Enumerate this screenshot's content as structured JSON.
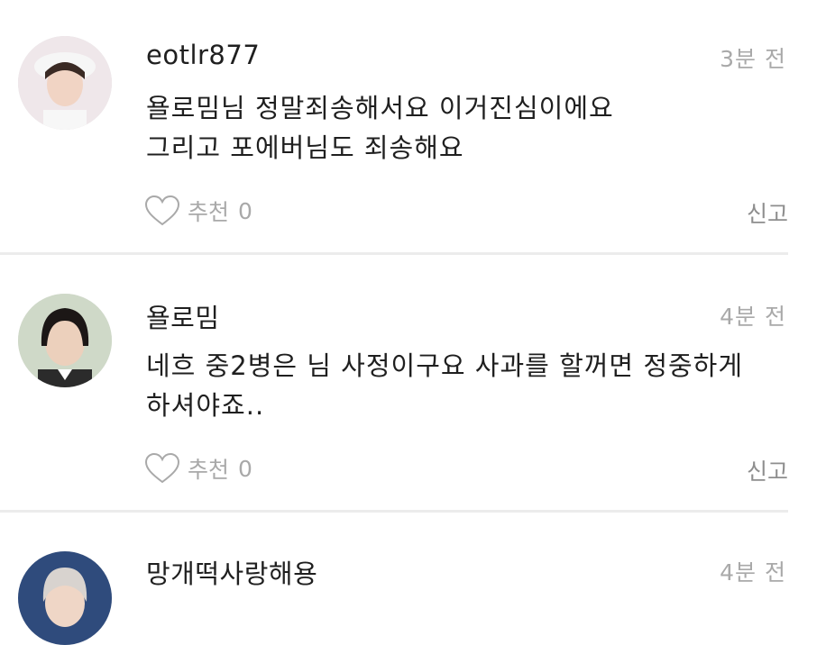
{
  "comments": [
    {
      "username": "eotlr877",
      "time": "3분 전",
      "body": "욜로밈님 정말죄송해서요 이거진심이에요\n그리고 포에버님도 죄송해요",
      "like_label": "추천",
      "like_count": "0",
      "report_label": "신고",
      "avatar_icon": "user-avatar-1"
    },
    {
      "username": "욜로밈",
      "time": "4분 전",
      "body": "네흐 중2병은 님 사정이구요 사과를 할꺼면 정중하게\n하셔야죠..",
      "like_label": "추천",
      "like_count": "0",
      "report_label": "신고",
      "avatar_icon": "user-avatar-2"
    },
    {
      "username": "망개떡사랑해용",
      "time": "4분 전",
      "body": "",
      "like_label": "",
      "like_count": "",
      "report_label": "",
      "avatar_icon": "user-avatar-3"
    }
  ],
  "colors": {
    "text": "#1f1f1f",
    "muted": "#a9a9a9",
    "divider": "#ececec"
  }
}
